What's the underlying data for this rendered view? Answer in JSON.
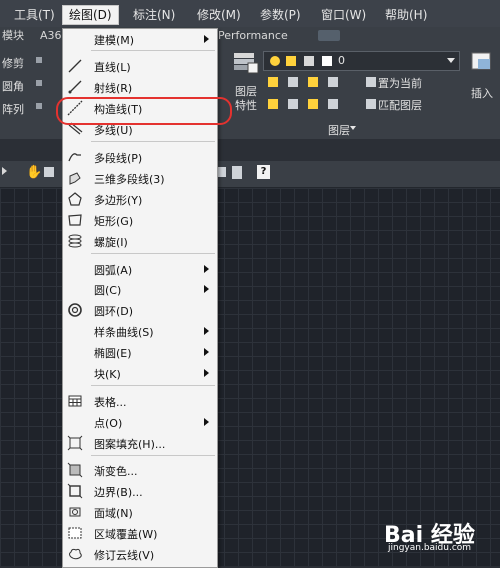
{
  "menubar": {
    "items": [
      {
        "label": "工具(T)"
      },
      {
        "label": "绘图(D)",
        "active": true
      },
      {
        "label": "标注(N)"
      },
      {
        "label": "修改(M)"
      },
      {
        "label": "参数(P)"
      },
      {
        "label": "窗口(W)"
      },
      {
        "label": "帮助(H)"
      }
    ]
  },
  "ribbon": {
    "tabs": [
      "模块",
      "A36",
      "Performance"
    ],
    "left_tools": [
      "修剪",
      "圆角",
      "阵列"
    ],
    "layer_panel": {
      "combo_value": "0",
      "buttons": [
        "置为当前",
        "匹配图层"
      ],
      "big_button": "图层\n特性",
      "title": "图层",
      "insert": "插入"
    }
  },
  "dropdown": {
    "items": [
      {
        "label": "建模(M)",
        "icon": "none",
        "submenu": true
      },
      {
        "label": "直线(L)",
        "icon": "line-icon"
      },
      {
        "label": "射线(R)",
        "icon": "ray-icon"
      },
      {
        "label": "构造线(T)",
        "icon": "xline-icon",
        "highlighted": true
      },
      {
        "label": "多线(U)",
        "icon": "multiline-icon"
      },
      {
        "label": "多段线(P)",
        "icon": "polyline-icon"
      },
      {
        "label": "三维多段线(3)",
        "icon": "3dpoly-icon"
      },
      {
        "label": "多边形(Y)",
        "icon": "polygon-icon"
      },
      {
        "label": "矩形(G)",
        "icon": "rectangle-icon"
      },
      {
        "label": "螺旋(I)",
        "icon": "helix-icon"
      },
      {
        "label": "圆弧(A)",
        "icon": "none",
        "submenu": true
      },
      {
        "label": "圆(C)",
        "icon": "none",
        "submenu": true
      },
      {
        "label": "圆环(D)",
        "icon": "donut-icon"
      },
      {
        "label": "样条曲线(S)",
        "icon": "none",
        "submenu": true
      },
      {
        "label": "椭圆(E)",
        "icon": "none",
        "submenu": true
      },
      {
        "label": "块(K)",
        "icon": "none",
        "submenu": true
      },
      {
        "label": "表格...",
        "icon": "table-icon"
      },
      {
        "label": "点(O)",
        "icon": "none",
        "submenu": true
      },
      {
        "label": "图案填充(H)...",
        "icon": "hatch-icon"
      },
      {
        "label": "渐变色...",
        "icon": "gradient-icon"
      },
      {
        "label": "边界(B)...",
        "icon": "boundary-icon"
      },
      {
        "label": "面域(N)",
        "icon": "region-icon"
      },
      {
        "label": "区域覆盖(W)",
        "icon": "wipeout-icon"
      },
      {
        "label": "修订云线(V)",
        "icon": "revcloud-icon"
      }
    ]
  },
  "watermark": {
    "logo_text": "Bai 经验",
    "url": "jingyan.baidu.com"
  },
  "colors": {
    "menubar_bg": "#3d424a",
    "dropdown_bg": "#f4f4f4",
    "highlight_ring": "#e4322f",
    "canvas_bg": "#1f232a"
  }
}
